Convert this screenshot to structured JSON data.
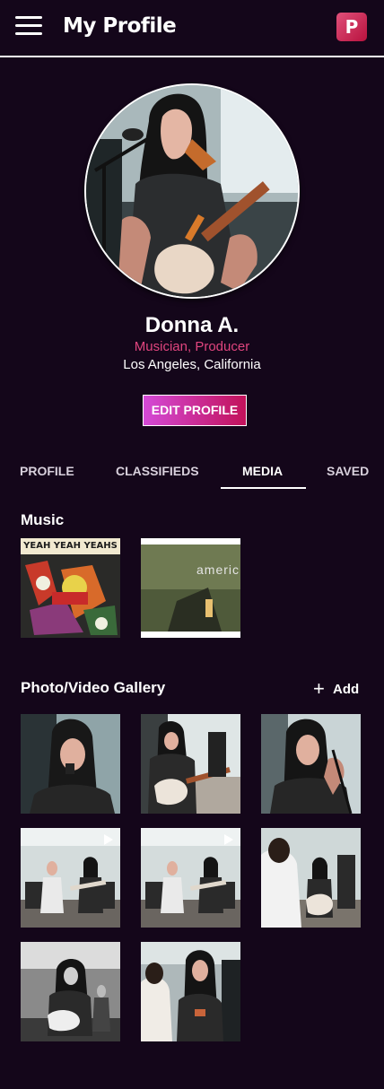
{
  "header": {
    "title": "My Profile",
    "logo_letter": "P"
  },
  "profile": {
    "name": "Donna A.",
    "role": "Musician, Producer",
    "location": "Los Angeles, California",
    "edit_label": "EDIT PROFILE"
  },
  "tabs": [
    {
      "label": "PROFILE",
      "active": false
    },
    {
      "label": "CLASSIFIEDS",
      "active": false
    },
    {
      "label": "MEDIA",
      "active": true
    },
    {
      "label": "SAVED",
      "active": false
    }
  ],
  "music": {
    "title": "Music",
    "albums": [
      {
        "cover_text": "YEAH YEAH YEAHS"
      },
      {
        "cover_text": "americ"
      }
    ]
  },
  "gallery": {
    "title": "Photo/Video Gallery",
    "add_label": "Add",
    "items": [
      {
        "type": "photo"
      },
      {
        "type": "photo"
      },
      {
        "type": "photo"
      },
      {
        "type": "video"
      },
      {
        "type": "video"
      },
      {
        "type": "photo"
      },
      {
        "type": "photo"
      },
      {
        "type": "photo"
      }
    ]
  },
  "colors": {
    "background": "#14061a",
    "accent_pink": "#e0457e",
    "button_gradient_start": "#d44ad7",
    "button_gradient_end": "#c2125a"
  }
}
